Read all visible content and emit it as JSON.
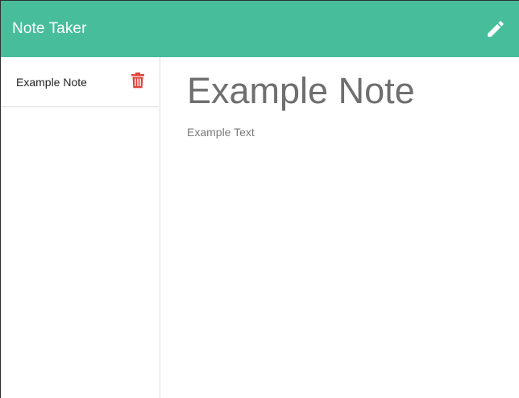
{
  "navbar": {
    "brand": "Note Taker",
    "new_note_icon": "pencil-icon",
    "color": "#47bd9c"
  },
  "sidebar": {
    "notes": [
      {
        "title": "Example Note",
        "delete_icon": "trash-icon"
      }
    ]
  },
  "main": {
    "note_title": "Example Note",
    "note_text": "Example Text"
  },
  "colors": {
    "delete": "#e0443b",
    "title_text": "#6f6f6f"
  }
}
